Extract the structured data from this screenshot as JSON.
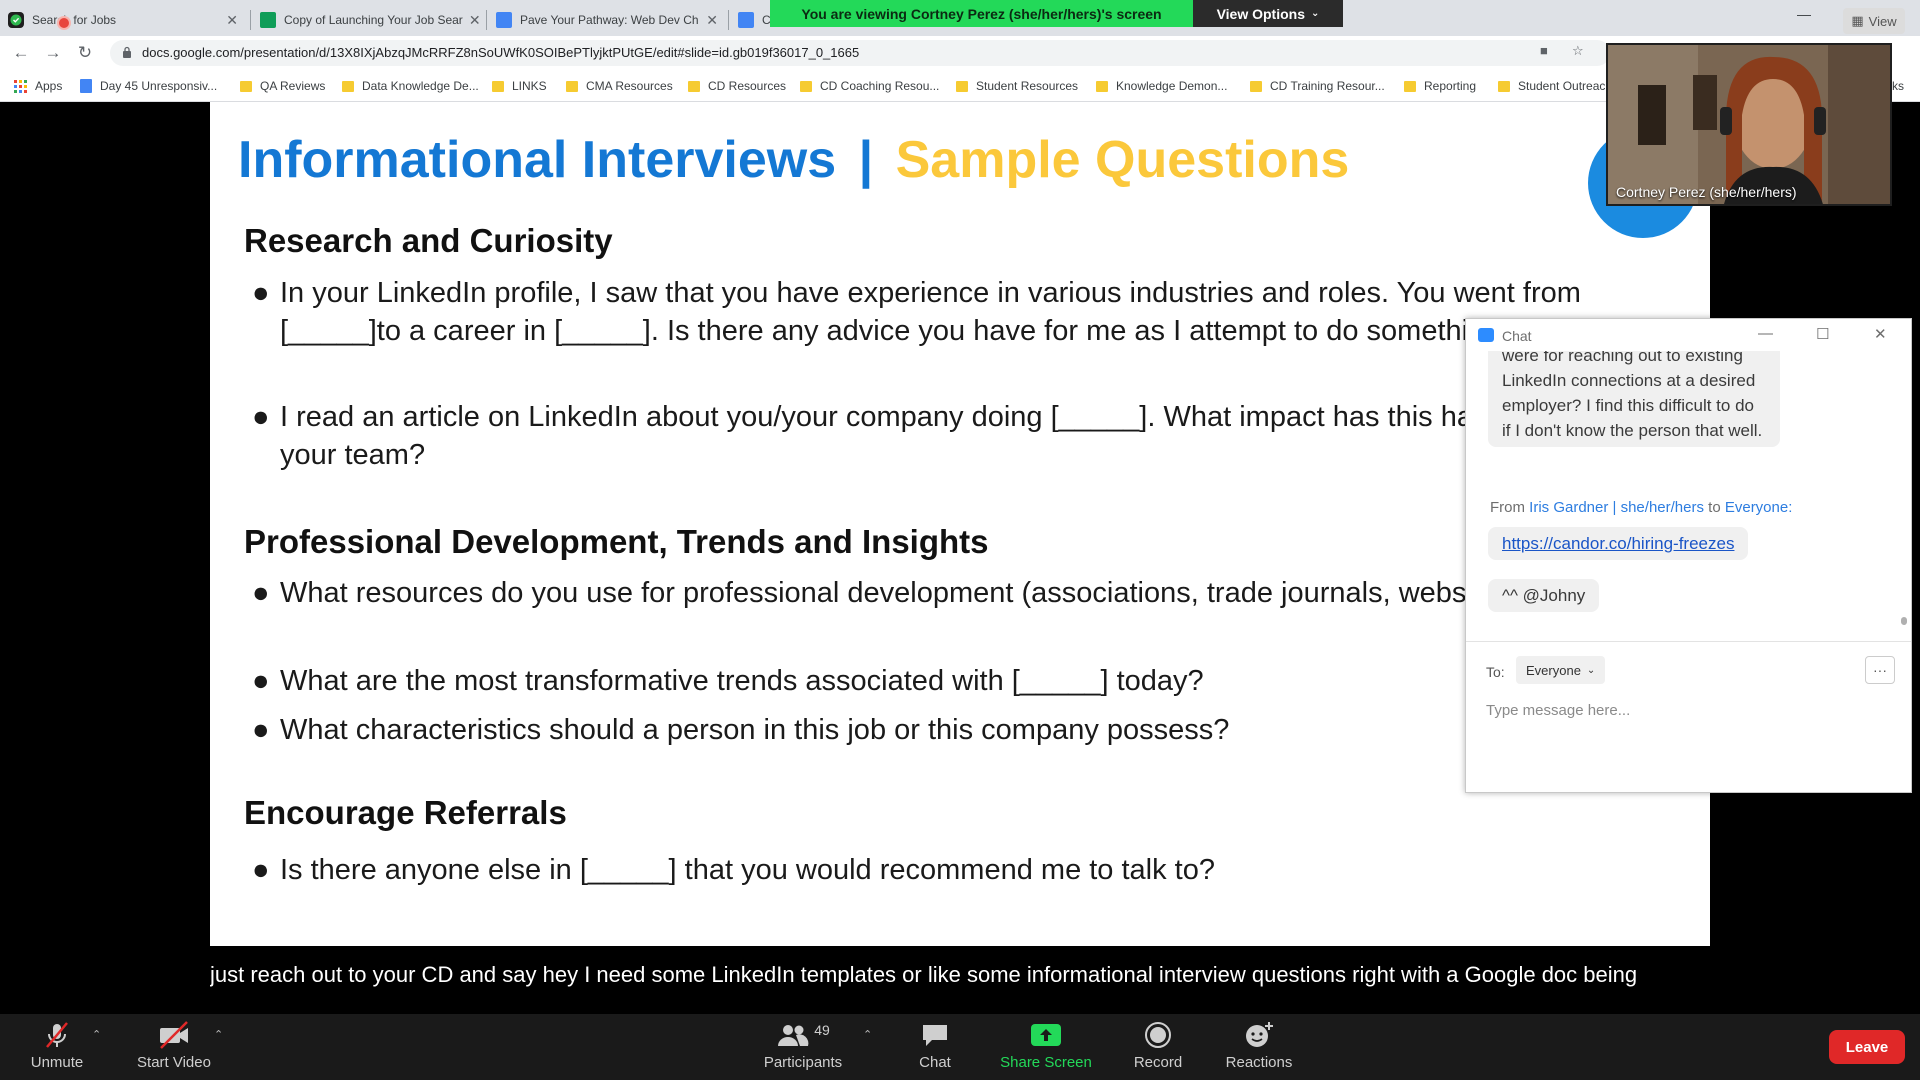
{
  "browser": {
    "tabs": [
      {
        "title": "Search for Jobs",
        "icon": "extension-shield-icon"
      },
      {
        "title": "Copy of Launching Your Job Sear",
        "icon": "google-sheets-icon"
      },
      {
        "title": "Pave Your Pathway: Web Dev Ch",
        "icon": "google-docs-icon"
      },
      {
        "title": "Co",
        "icon": "google-docs-icon"
      }
    ],
    "url": "docs.google.com/presentation/d/13X8IXjAbzqJMcRRFZ8nSoUWfK0SOIBePTlyjktPUtGE/edit#slide=id.gb019f36017_0_1665",
    "bookmarks": [
      {
        "label": "Apps",
        "kind": "apps"
      },
      {
        "label": "Day 45 Unresponsiv...",
        "kind": "doc"
      },
      {
        "label": "QA Reviews",
        "kind": "folder"
      },
      {
        "label": "Data Knowledge De...",
        "kind": "folder"
      },
      {
        "label": "LINKS",
        "kind": "folder"
      },
      {
        "label": "CMA Resources",
        "kind": "folder"
      },
      {
        "label": "CD Resources",
        "kind": "folder"
      },
      {
        "label": "CD Coaching Resou...",
        "kind": "folder"
      },
      {
        "label": "Student Resources",
        "kind": "folder"
      },
      {
        "label": "Knowledge Demon...",
        "kind": "folder"
      },
      {
        "label": "CD Training Resour...",
        "kind": "folder"
      },
      {
        "label": "Reporting",
        "kind": "folder"
      },
      {
        "label": "Student Outreac",
        "kind": "folder"
      }
    ],
    "bookmark_trailing": "ks"
  },
  "share_banner": {
    "viewing_text": "You are viewing Cortney Perez (she/her/hers)'s screen",
    "view_options_label": "View Options",
    "accent": "#23d959"
  },
  "slide": {
    "title_part1": "Informational Interviews",
    "title_sep": "|",
    "title_part2": "Sample Questions",
    "title_color1": "#1478d4",
    "title_color2": "#fbc83b",
    "sections": [
      {
        "heading": "Research and Curiosity",
        "bullets": [
          "In your LinkedIn profile, I saw that you have experience in various industries and roles. You went from [_____]to a career in  [_____]. Is there any advice you have for me as I attempt to do something similar?",
          "I read an article on LinkedIn about you/your company doing  [_____]. What impact has this had on you and your team?"
        ]
      },
      {
        "heading": "Professional Development, Trends and Insights",
        "bullets": [
          "What resources do you use for professional development (associations, trade journals, websites, etc.)?",
          "What are the most transformative trends associated with [_____] today?",
          "What characteristics should a person in this job or this company possess?"
        ]
      },
      {
        "heading": "Encourage Referrals",
        "bullets": [
          "Is there anyone else in [_____] that you would recommend me to talk to?"
        ]
      }
    ]
  },
  "caption": "just reach out to your CD and say hey I need some LinkedIn templates or like some informational interview questions right with a Google doc being",
  "video": {
    "participant_name": "Cortney Perez (she/her/hers)",
    "view_label": "View"
  },
  "chat": {
    "title": "Chat",
    "partial_message": "were for reaching out to existing LinkedIn connections at a desired employer? I find this difficult to do if I don't know the person that well.",
    "from_prefix": "From",
    "from_sender": "Iris Gardner | she/her/hers",
    "from_to": "to",
    "from_recipient": "Everyone:",
    "link_message": "https://candor.co/hiring-freezes",
    "reply_message": "^^ @Johny",
    "to_label": "To:",
    "to_value": "Everyone",
    "more_label": "···",
    "input_placeholder": "Type message here..."
  },
  "toolbar": {
    "unmute": "Unmute",
    "start_video": "Start Video",
    "participants": "Participants",
    "participants_count": "49",
    "chat": "Chat",
    "share_screen": "Share Screen",
    "record": "Record",
    "reactions": "Reactions",
    "leave": "Leave",
    "leave_color": "#e02828"
  }
}
